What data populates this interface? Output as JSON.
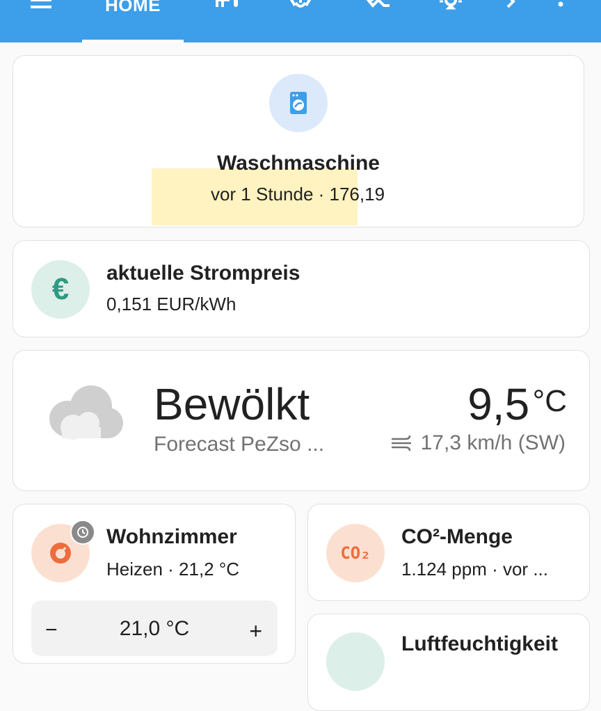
{
  "header": {
    "tab_home": "HOME",
    "icons": [
      "menu-icon",
      "floorplan-icon",
      "lightbulb-icon",
      "robot-vacuum-icon",
      "ceiling-light-icon",
      "chevron-right-icon",
      "more-vert-icon"
    ]
  },
  "washer": {
    "name": "Waschmaschine",
    "state": "vor 1 Stunde · 176,19",
    "icon": "washing-machine-icon"
  },
  "price": {
    "name": "aktuelle Strompreis",
    "state": "0,151 EUR/kWh",
    "icon_glyph": "€"
  },
  "weather": {
    "condition": "Bewölkt",
    "source": "Forecast PeZso ...",
    "temperature": "9,5",
    "unit": "°C",
    "wind": "17,3 km/h (SW)"
  },
  "thermostat": {
    "name": "Wohnzimmer",
    "state": "Heizen · 21,2 °C",
    "target": "21,0 °C",
    "minus": "−",
    "plus": "+"
  },
  "co2": {
    "name": "CO²-Menge",
    "state": "1.124 ppm · vor ...",
    "icon_text": "CO₂"
  },
  "humidity": {
    "name": "Luftfeuchtigkeit"
  },
  "colors": {
    "header_bg": "#3d9ee9",
    "washer_icon_bg": "#dbe9fb",
    "washer_icon": "#3d9ee9",
    "price_icon_bg": "#dcefe9",
    "price_icon": "#2f9a82",
    "heat_icon_bg": "#fbe0d2",
    "heat_icon": "#ef6c3c",
    "co2_icon_bg": "#fbe0d2",
    "co2_icon": "#ef6c3c"
  }
}
